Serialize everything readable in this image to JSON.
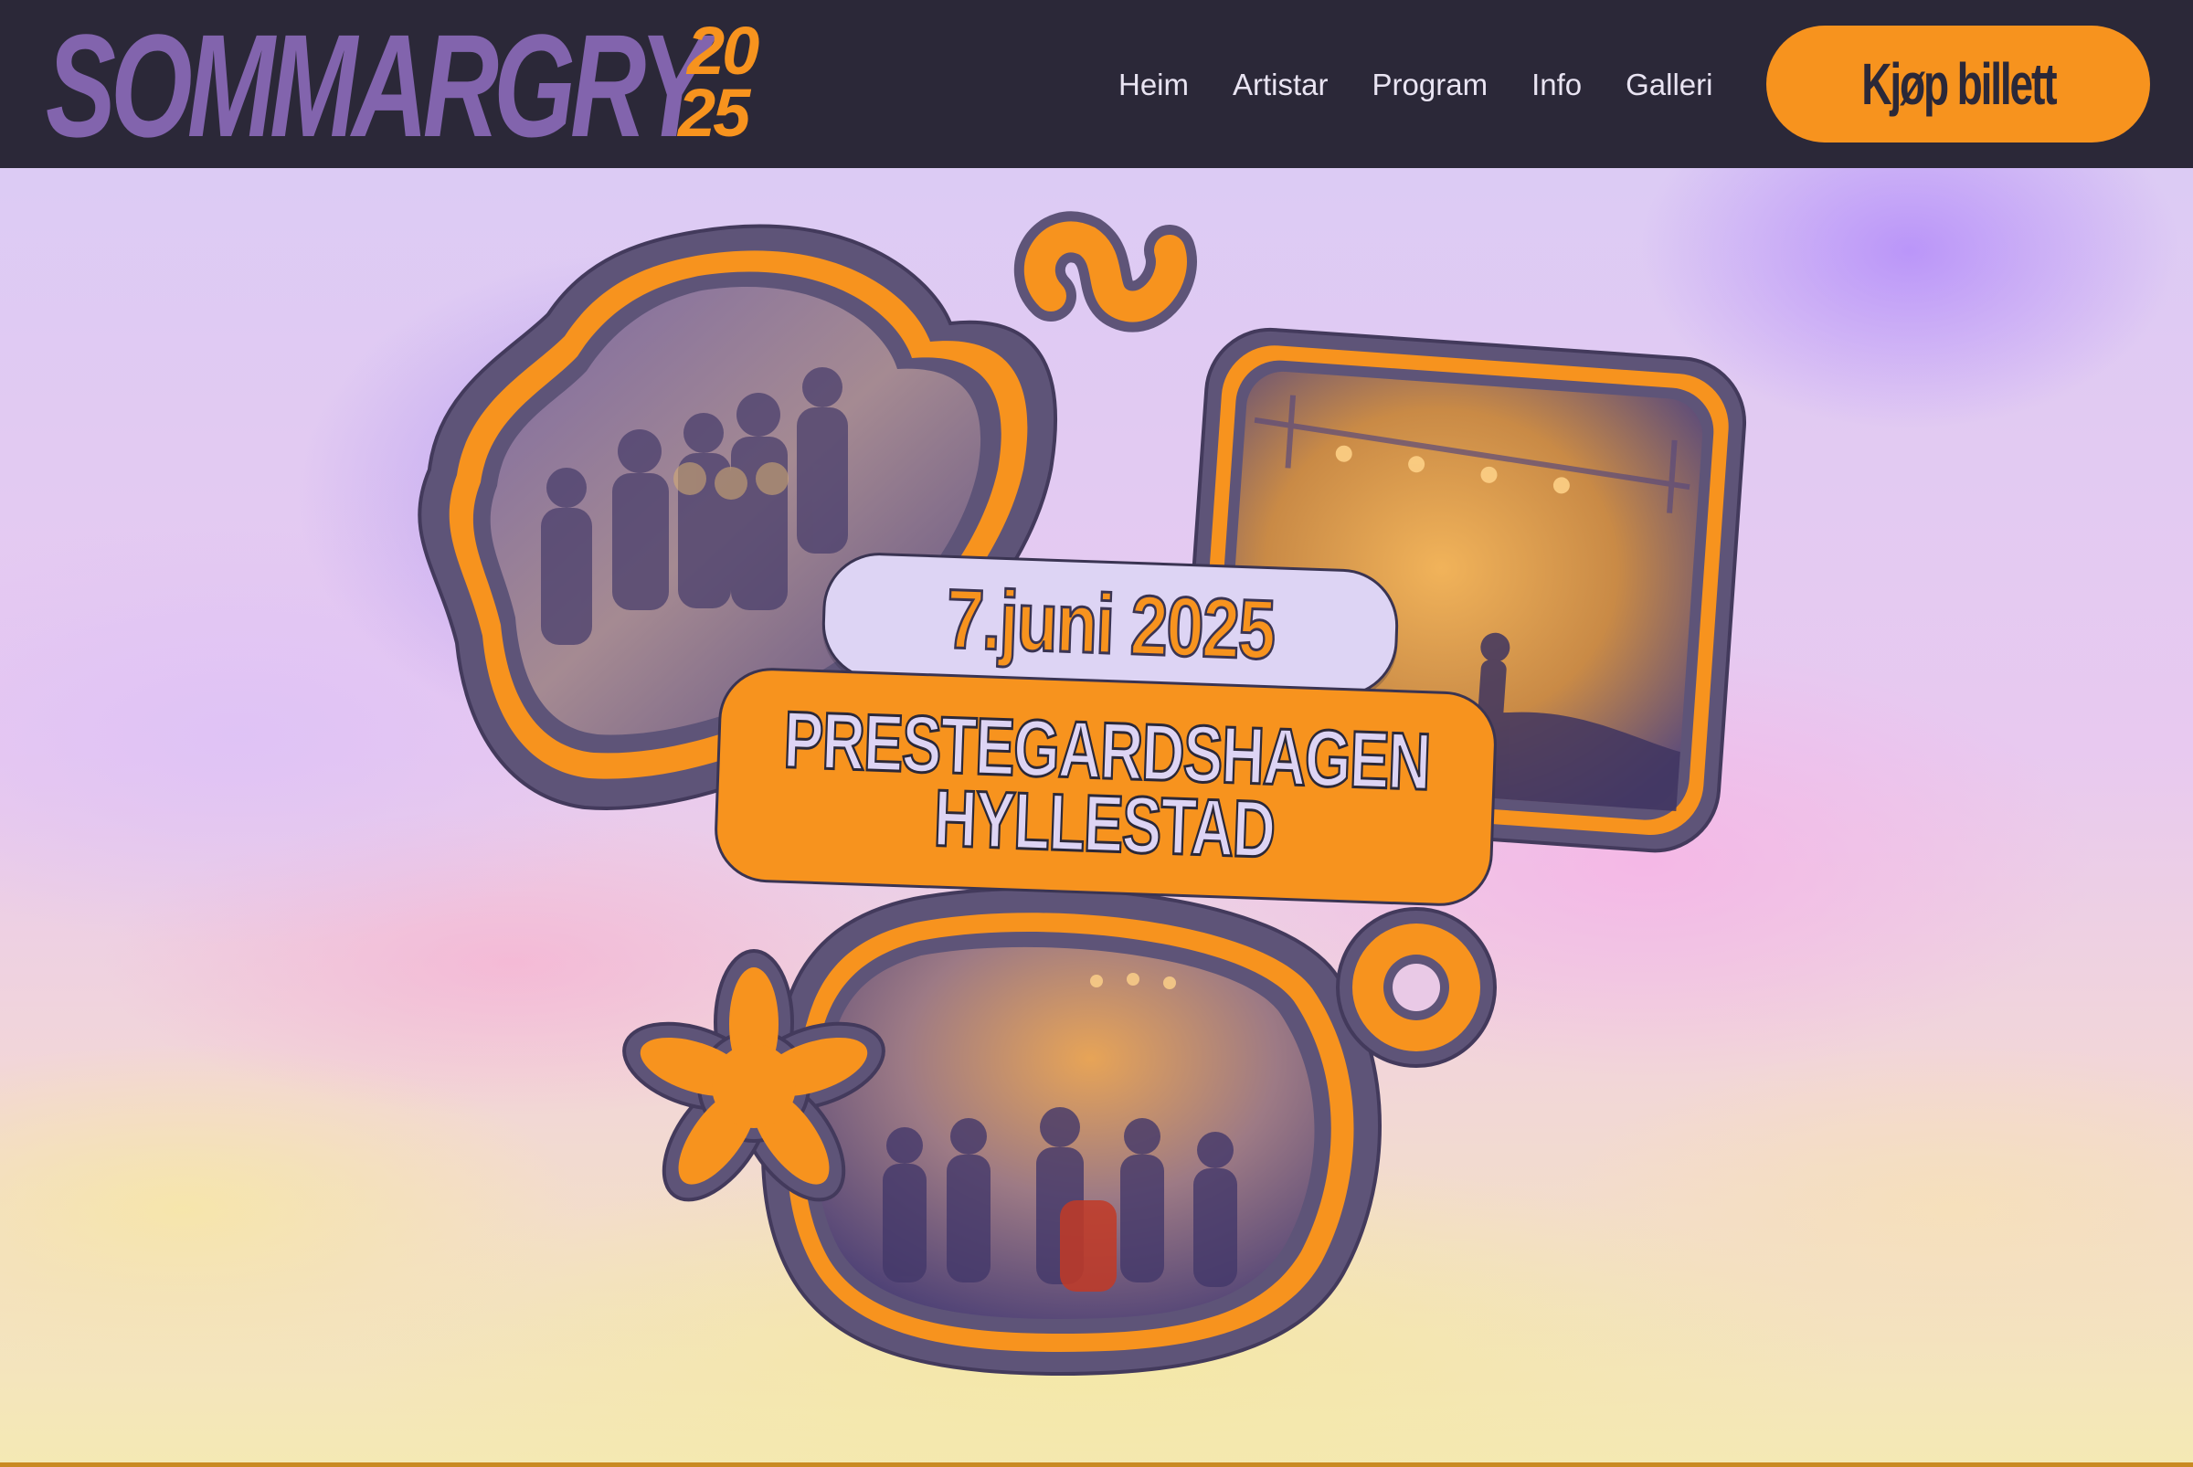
{
  "header": {
    "logo_word": "SOMMARGRY",
    "logo_year_top": "20",
    "logo_year_bottom": "25",
    "nav": [
      {
        "label": "Heim"
      },
      {
        "label": "Artistar"
      },
      {
        "label": "Program"
      },
      {
        "label": "Info"
      },
      {
        "label": "Galleri"
      }
    ],
    "cta_label": "Kjøp billett"
  },
  "hero": {
    "date": "7.juni 2025",
    "venue_line1": "PRESTEGARDSHAGEN",
    "venue_line2": "HYLLESTAD",
    "photos": [
      {
        "icon": "crowd-photo"
      },
      {
        "icon": "stage-lights-photo"
      },
      {
        "icon": "concert-crowd-photo"
      }
    ]
  },
  "colors": {
    "header_bg": "#2b2838",
    "brand_purple": "#8264ad",
    "accent_orange": "#f7931e",
    "nav_text": "#e9e4f2",
    "outline": "#5e5478"
  }
}
